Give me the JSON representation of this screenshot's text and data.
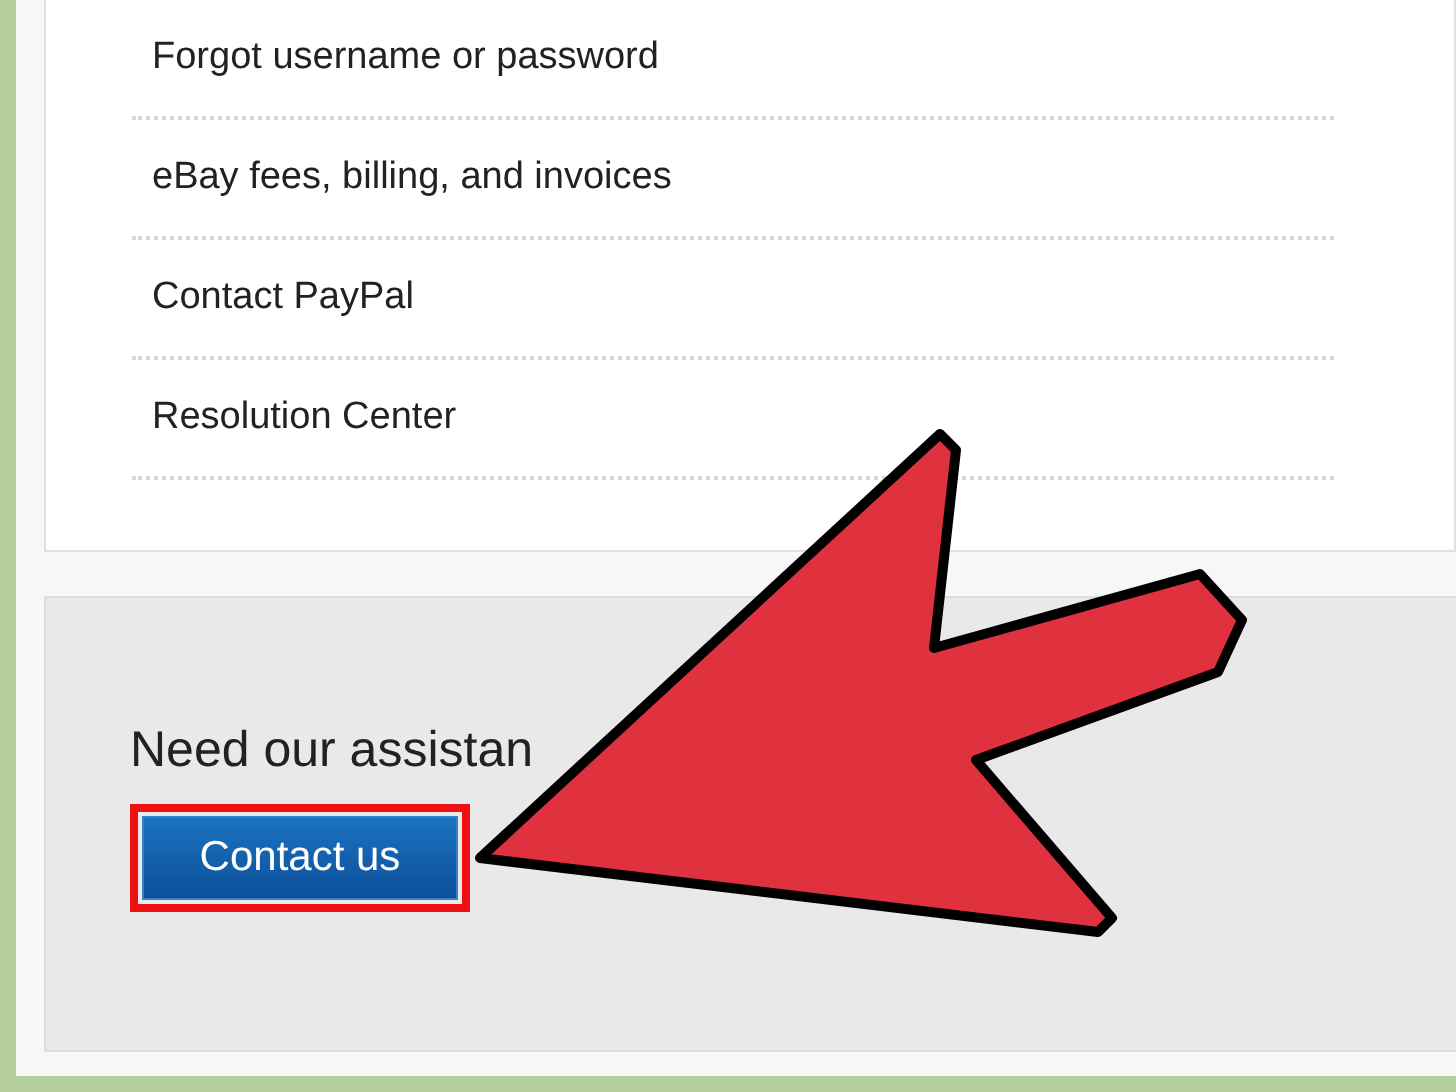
{
  "help_links": [
    {
      "label": "Forgot username or password"
    },
    {
      "label": "eBay fees, billing, and invoices"
    },
    {
      "label": "Contact PayPal"
    },
    {
      "label": "Resolution Center"
    }
  ],
  "assistance": {
    "heading": "Need our assistan",
    "button": "Contact us"
  }
}
